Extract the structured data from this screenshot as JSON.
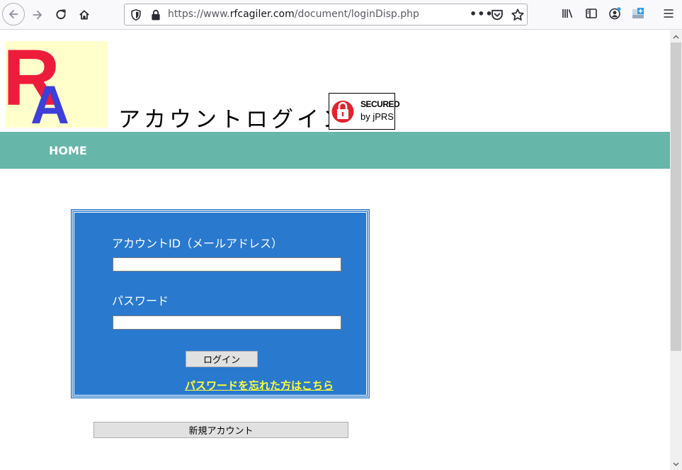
{
  "browser": {
    "url_prefix": "https://www.",
    "url_host": "rfcagiler.com",
    "url_path": "/document/loginDisp.php",
    "more_label": "•••"
  },
  "header": {
    "logo_letter_1": "R",
    "logo_letter_2": "A",
    "title": "アカウントログイン",
    "badge_line1": "SECURED",
    "badge_line2": "by jPRS"
  },
  "nav": {
    "home_label": "HOME"
  },
  "login": {
    "id_label": "アカウントID（メールアドレス）",
    "id_value": "",
    "password_label": "パスワード",
    "password_value": "",
    "login_button": "ログイン",
    "forgot_link": "パスワードを忘れた方はこちら"
  },
  "new_account_button": "新規アカウント",
  "colors": {
    "nav_bar": "#66b6a9",
    "panel": "#2979cf",
    "link": "#ffff33",
    "logo_bg": "#ffffcc",
    "logo_r": "#ee1c3b",
    "logo_a": "#3d3fd8"
  }
}
